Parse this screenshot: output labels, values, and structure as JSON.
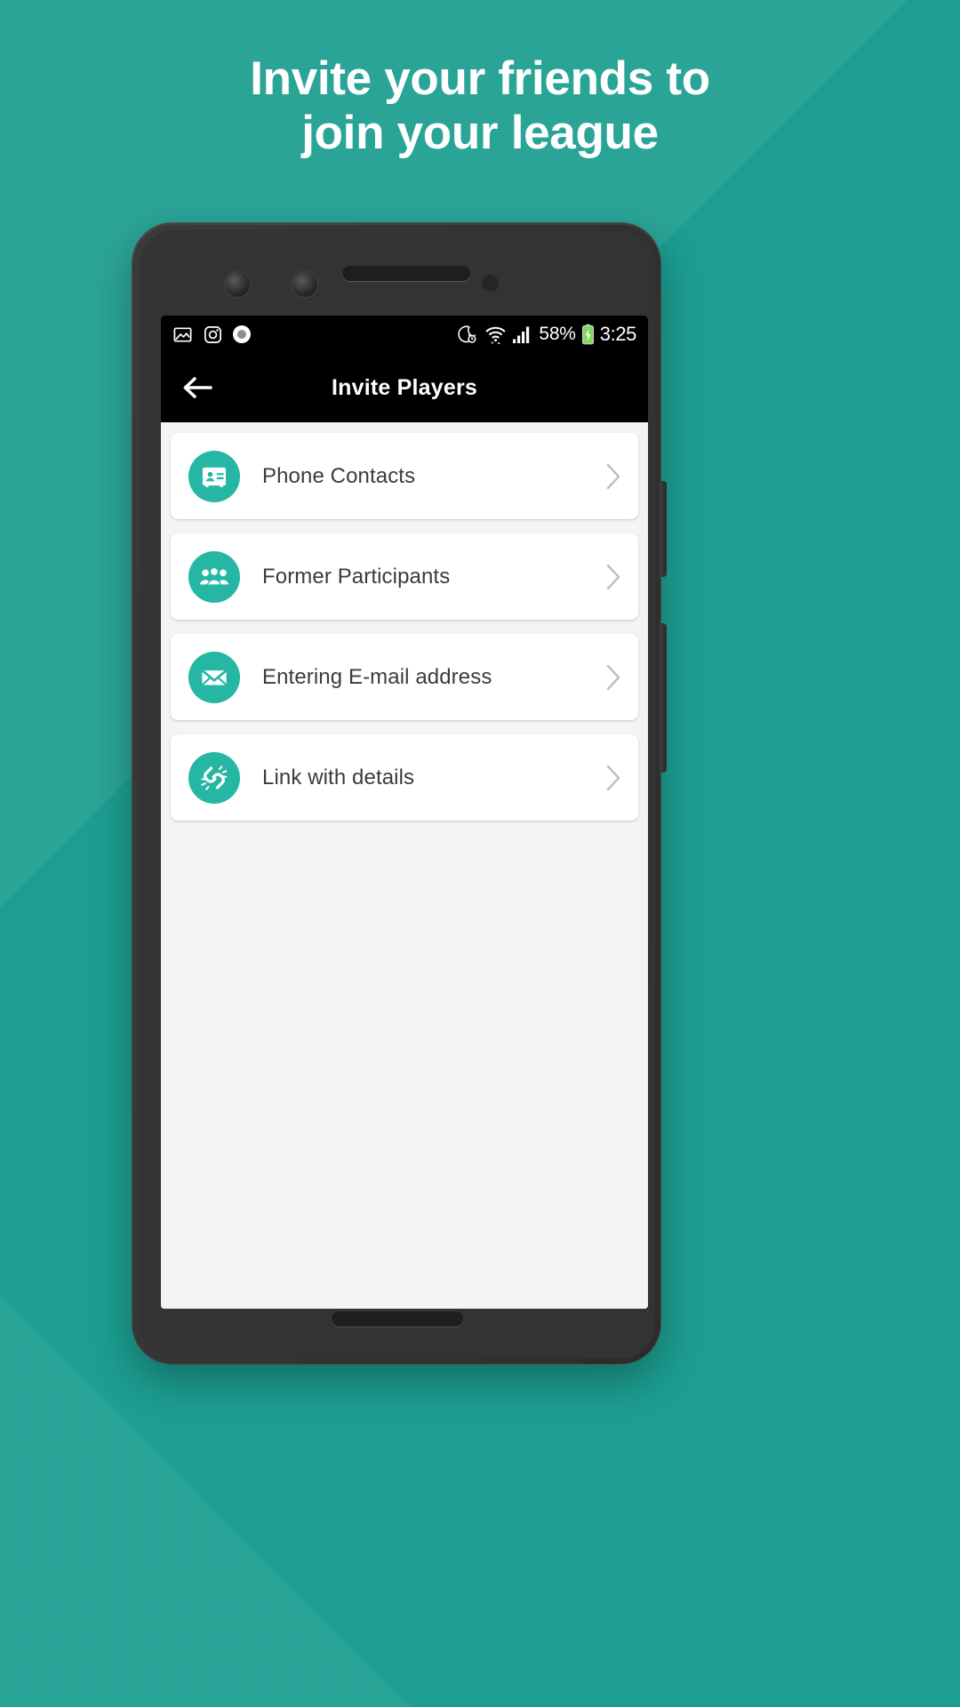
{
  "promo": {
    "headline_line1": "Invite your friends to",
    "headline_line2": "join your league",
    "background_color": "#1c9e91",
    "headline_color": "#ffffff"
  },
  "phone": {
    "status_bar": {
      "left_icons": [
        "image-icon",
        "instagram-icon",
        "screen-record-icon"
      ],
      "right_icons": [
        "do-not-disturb-alarm-icon",
        "wifi-icon",
        "cellular-signal-icon",
        "battery-charging-icon"
      ],
      "battery_percent": "58%",
      "time": "3:25",
      "battery_color": "#7ed957"
    },
    "app_bar": {
      "back_label": "back-arrow",
      "title": "Invite Players"
    },
    "invite_options": [
      {
        "label": "Phone Contacts",
        "icon": "contact-card-icon",
        "chevron": "chevron-right-icon"
      },
      {
        "label": "Former Participants",
        "icon": "people-group-icon",
        "chevron": "chevron-right-icon"
      },
      {
        "label": "Entering E-mail address",
        "icon": "envelope-icon",
        "chevron": "chevron-right-icon"
      },
      {
        "label": "Link with details",
        "icon": "broken-link-icon",
        "chevron": "chevron-right-icon"
      }
    ],
    "accent_color": "#25b7a4",
    "card_background": "#ffffff",
    "screen_background": "#f4f4f4",
    "app_bar_color": "#000000"
  }
}
